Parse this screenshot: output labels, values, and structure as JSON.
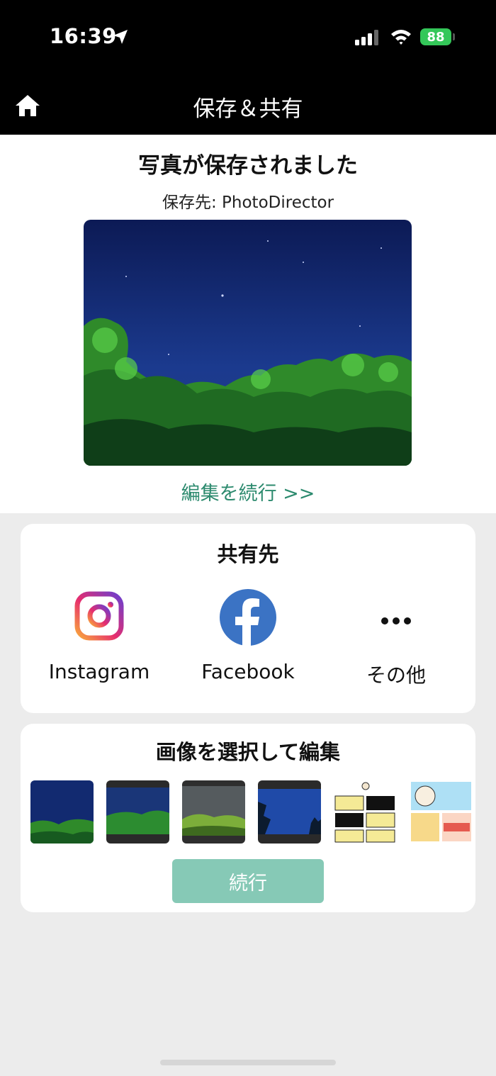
{
  "status_bar": {
    "time": "16:39",
    "battery": "88"
  },
  "nav": {
    "title": "保存＆共有"
  },
  "saved": {
    "title": "写真が保存されました",
    "location": "保存先: PhotoDirector",
    "continue_edit": "編集を続行 >>"
  },
  "share": {
    "title": "共有先",
    "items": [
      {
        "label": "Instagram",
        "icon": "instagram-icon"
      },
      {
        "label": "Facebook",
        "icon": "facebook-icon"
      },
      {
        "label": "その他",
        "icon": "more-icon"
      }
    ]
  },
  "select": {
    "title": "画像を選択して編集",
    "continue_label": "続行"
  },
  "colors": {
    "accent": "#2c8a6e",
    "button": "#86c9b6",
    "battery": "#34c759"
  }
}
